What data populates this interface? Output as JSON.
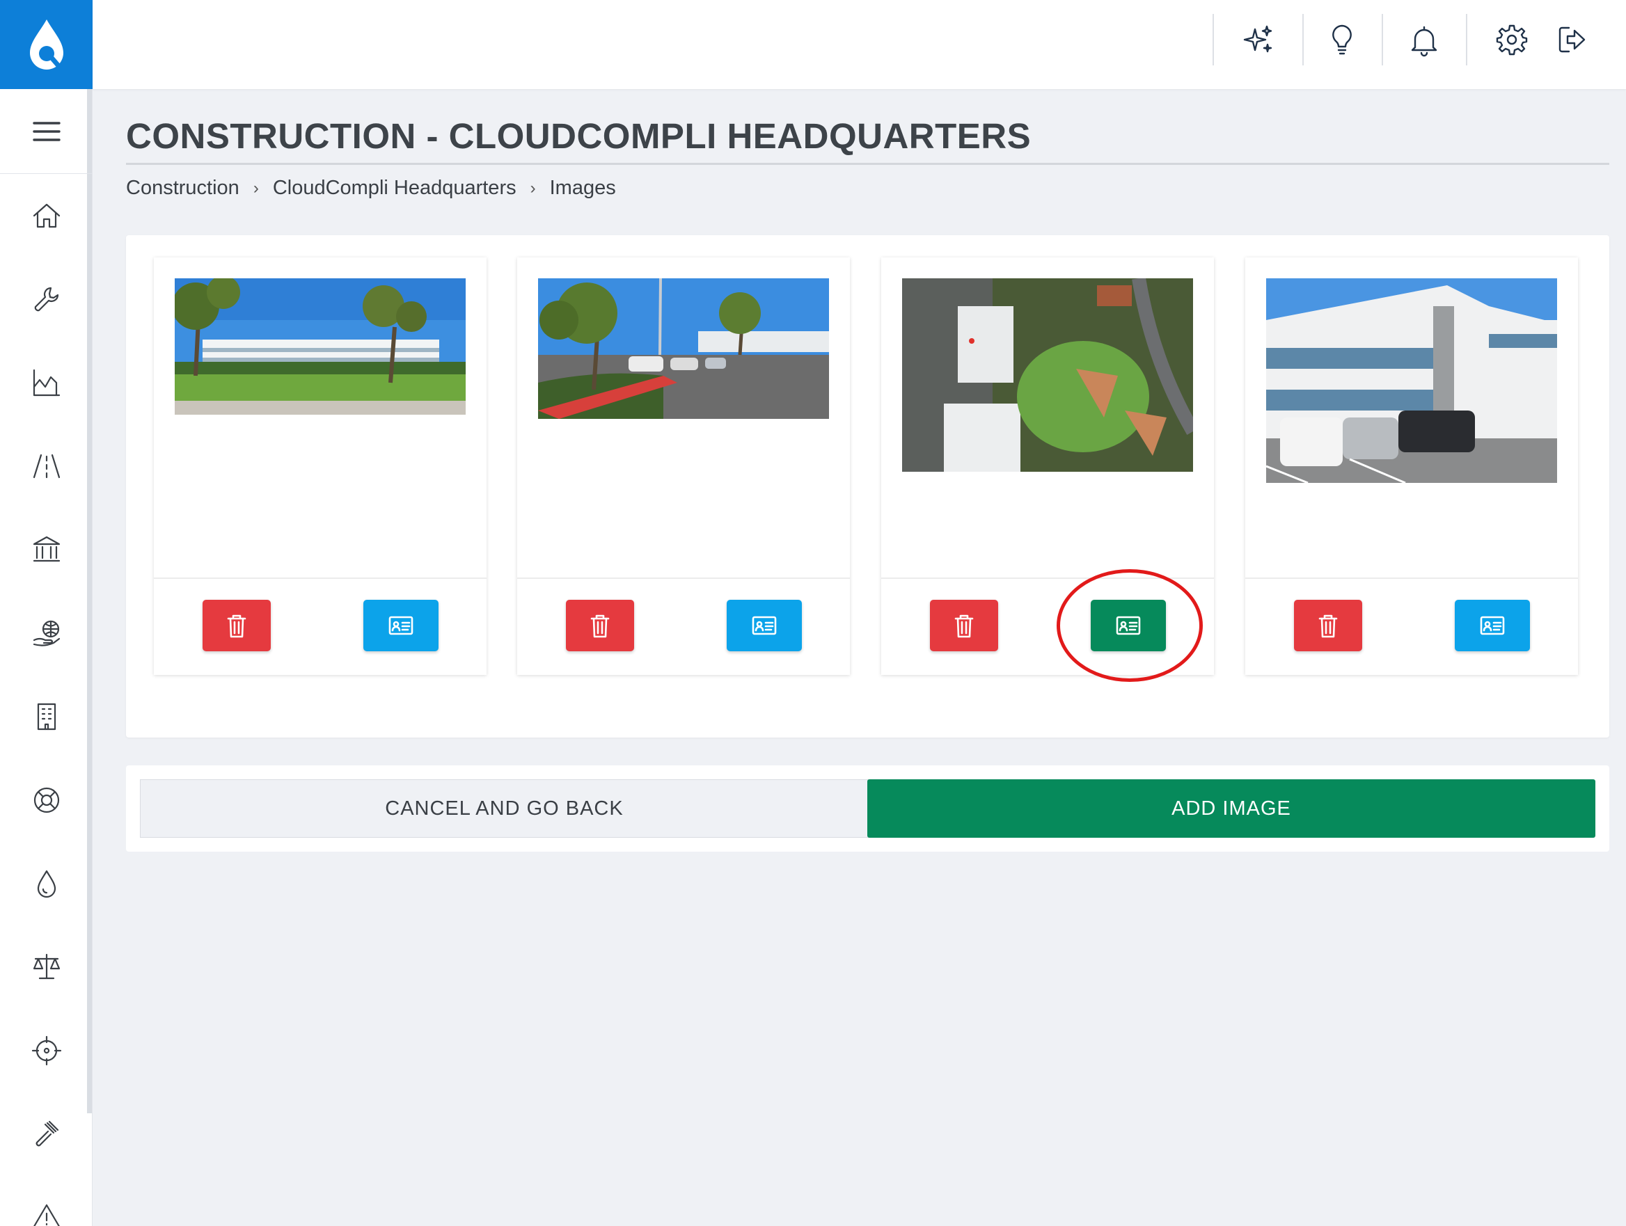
{
  "app": {
    "brand_color": "#0d7fd8",
    "logo_icon": "droplet-logo-icon"
  },
  "topbar": {
    "icons": [
      "sparkles-icon",
      "lightbulb-icon",
      "bell-icon",
      "gear-icon",
      "logout-icon"
    ]
  },
  "sidebar": {
    "menu_icon": "hamburger-menu-icon",
    "items": [
      "home-icon",
      "wrench-icon",
      "chart-icon",
      "road-icon",
      "bank-icon",
      "globe-hand-icon",
      "building-icon",
      "lifebuoy-icon",
      "droplet-icon",
      "scales-icon",
      "crosshair-icon",
      "gavel-icon",
      "warning-icon"
    ]
  },
  "page": {
    "title": "CONSTRUCTION - CLOUDCOMPLI HEADQUARTERS",
    "breadcrumb": [
      "Construction",
      "CloudCompli Headquarters",
      "Images"
    ]
  },
  "images": [
    {
      "subject": "office park with trees",
      "selected": false
    },
    {
      "subject": "parking lot with trees",
      "selected": false
    },
    {
      "subject": "aerial view of building and fields",
      "selected": true
    },
    {
      "subject": "white office building with parked cars",
      "selected": false
    }
  ],
  "actions": {
    "cancel_label": "CANCEL AND GO BACK",
    "add_label": "ADD IMAGE"
  },
  "colors": {
    "delete": "#e53a3f",
    "card_button": "#0ca3ea",
    "card_button_active": "#068a5b",
    "add": "#068a5b",
    "highlight": "#e21a1a"
  }
}
